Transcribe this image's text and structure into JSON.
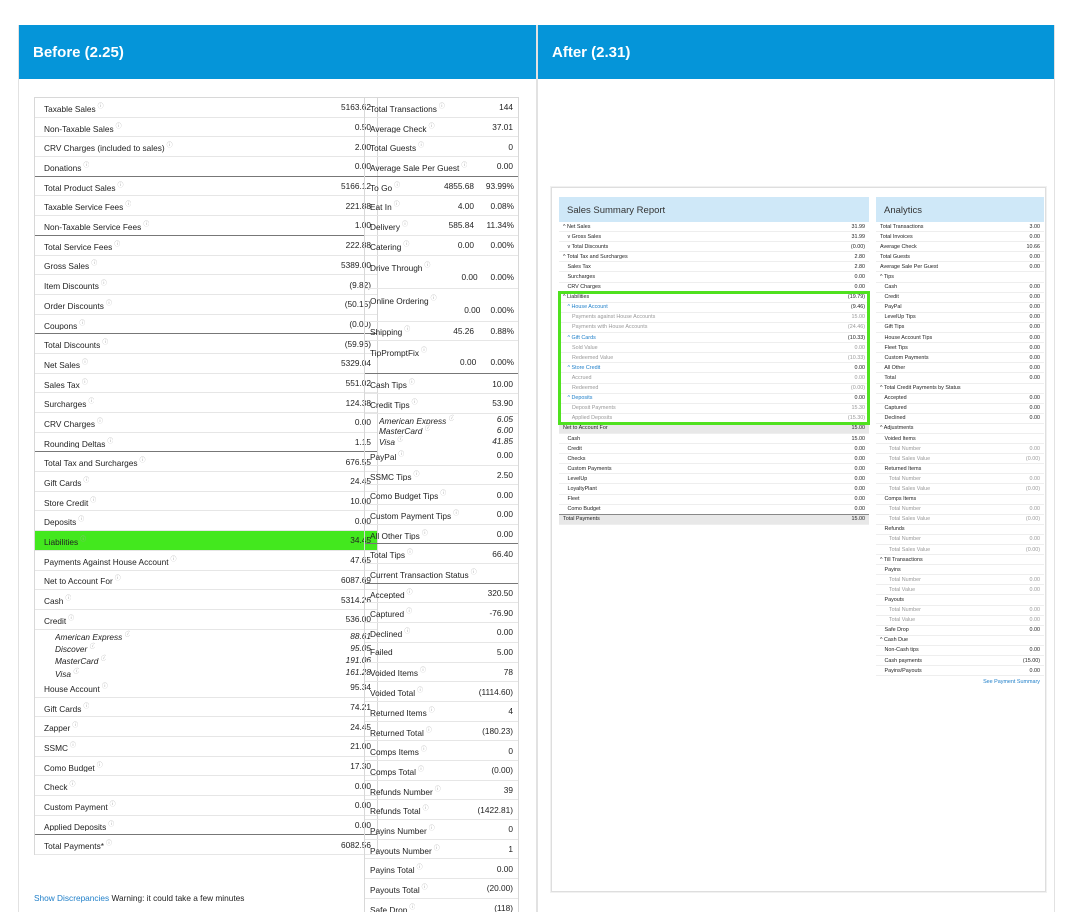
{
  "before_title": "Before (2.25)",
  "after_title": "After (2.31)",
  "old_left": [
    {
      "l": "Taxable Sales",
      "v": "5163.62",
      "i": 1
    },
    {
      "l": "Non-Taxable Sales",
      "v": "0.50",
      "i": 1
    },
    {
      "l": "CRV Charges (included to sales)",
      "v": "2.00",
      "i": 1
    },
    {
      "l": "Donations",
      "v": "0.00",
      "i": 1,
      "bt": 1
    },
    {
      "l": "Total Product Sales",
      "v": "5166.12",
      "i": 1
    },
    {
      "l": "Taxable Service Fees",
      "v": "221.88",
      "i": 1
    },
    {
      "l": "Non-Taxable Service Fees",
      "v": "1.00",
      "i": 1,
      "bt": 1
    },
    {
      "l": "Total Service Fees",
      "v": "222.88",
      "i": 1
    },
    {
      "l": "Gross Sales",
      "v": "5389.00",
      "i": 1
    },
    {
      "l": "Item Discounts",
      "v": "(9.82)",
      "i": 1
    },
    {
      "l": "Order Discounts",
      "v": "(50.15)",
      "i": 1
    },
    {
      "l": "Coupons",
      "v": "(0.00)",
      "i": 1,
      "bt": 1
    },
    {
      "l": "Total Discounts",
      "v": "(59.96)",
      "i": 1
    },
    {
      "l": "Net Sales",
      "v": "5329.04",
      "i": 1
    },
    {
      "l": "Sales Tax",
      "v": "551.02",
      "i": 1
    },
    {
      "l": "Surcharges",
      "v": "124.38",
      "i": 1
    },
    {
      "l": "CRV Charges",
      "v": "0.00",
      "i": 1
    },
    {
      "l": "Rounding Deltas",
      "v": "1.15",
      "i": 1,
      "bt": 1
    },
    {
      "l": "Total Tax and Surcharges",
      "v": "676.55",
      "i": 1
    },
    {
      "l": "Gift Cards",
      "v": "24.45",
      "i": 1
    },
    {
      "l": "Store Credit",
      "v": "10.00",
      "i": 1
    },
    {
      "l": "Deposits",
      "v": "0.00",
      "i": 1
    },
    {
      "l": "Liabilities",
      "v": "34.45",
      "i": 1,
      "hl": 1
    },
    {
      "l": "Payments Against House Account",
      "v": "47.65",
      "i": 1
    },
    {
      "l": "Net to Account For",
      "v": "6087.69",
      "i": 1
    },
    {
      "l": "Cash",
      "v": "5314.26",
      "i": 1
    },
    {
      "l": "Credit",
      "v": "536.00",
      "i": 1
    },
    {
      "l": "American Express",
      "v": "88.61",
      "i": 1,
      "sub": 1
    },
    {
      "l": "Discover",
      "v": "95.05",
      "i": 1,
      "sub": 1
    },
    {
      "l": "MasterCard",
      "v": "191.06",
      "i": 1,
      "sub": 1
    },
    {
      "l": "Visa",
      "v": "161.28",
      "i": 1,
      "sub": 1
    },
    {
      "l": "House Account",
      "v": "95.34",
      "i": 1
    },
    {
      "l": "Gift Cards",
      "v": "74.21",
      "i": 1
    },
    {
      "l": "Zapper",
      "v": "24.45",
      "i": 1
    },
    {
      "l": "SSMC",
      "v": "21.00",
      "i": 1
    },
    {
      "l": "Como Budget",
      "v": "17.30",
      "i": 1
    },
    {
      "l": "Check",
      "v": "0.00",
      "i": 1
    },
    {
      "l": "Custom Payment",
      "v": "0.00",
      "i": 1
    },
    {
      "l": "Applied Deposits",
      "v": "0.00",
      "i": 1,
      "bt": 1
    },
    {
      "l": "Total Payments*",
      "v": "6082.56",
      "i": 1
    }
  ],
  "old_footer_link": "Show Discrepancies",
  "old_footer_text": " Warning: it could take a few minutes",
  "old_right": [
    {
      "l": "Total Transactions",
      "v": "144",
      "i": 1
    },
    {
      "l": "Average Check",
      "v": "37.01",
      "i": 1
    },
    {
      "l": "Total Guests",
      "v": "0",
      "i": 1
    },
    {
      "l": "Average Sale Per Guest",
      "v": "0.00",
      "i": 1,
      "bt": 1
    },
    {
      "l": "To Go",
      "a": "4855.68",
      "b": "93.99%",
      "i": 1,
      "t3": 1
    },
    {
      "l": "Eat In",
      "a": "4.00",
      "b": "0.08%",
      "i": 1,
      "t3": 1
    },
    {
      "l": "Delivery",
      "a": "585.84",
      "b": "11.34%",
      "i": 1,
      "t3": 1
    },
    {
      "l": "Catering",
      "a": "0.00",
      "b": "0.00%",
      "i": 1,
      "t3": 1
    },
    {
      "l": "Drive Through",
      "a": "0.00",
      "b": "0.00%",
      "i": 1,
      "t3": 1,
      "tall": 1
    },
    {
      "l": "Online Ordering",
      "a": "0.00",
      "b": "0.00%",
      "i": 1,
      "t3": 1,
      "tall": 1
    },
    {
      "l": "Shipping",
      "a": "45.26",
      "b": "0.88%",
      "i": 1,
      "t3": 1
    },
    {
      "l": "TipPromptFix",
      "a": "0.00",
      "b": "0.00%",
      "i": 1,
      "t3": 1,
      "tall": 1,
      "bt": 1
    },
    {
      "l": "Cash Tips",
      "v": "10.00",
      "i": 1
    },
    {
      "l": "Credit Tips",
      "v": "53.90",
      "i": 1
    },
    {
      "l": "American Express",
      "v": "6.05",
      "i": 1,
      "sub2": 1
    },
    {
      "l": "MasterCard",
      "v": "6.00",
      "i": 1,
      "sub2": 1
    },
    {
      "l": "Visa",
      "v": "41.85",
      "i": 1,
      "sub2": 1
    },
    {
      "l": "PayPal",
      "v": "0.00",
      "i": 1
    },
    {
      "l": "SSMC Tips",
      "v": "2.50",
      "i": 1
    },
    {
      "l": "Como Budget Tips",
      "v": "0.00",
      "i": 1
    },
    {
      "l": "Custom Payment Tips",
      "v": "0.00",
      "i": 1
    },
    {
      "l": "All Other Tips",
      "v": "0.00",
      "i": 1,
      "bt": 1
    },
    {
      "l": "Total Tips",
      "v": "66.40",
      "i": 1
    },
    {
      "l": "Current Transaction Status",
      "v": "",
      "i": 1,
      "bt": 1
    },
    {
      "l": "Accepted",
      "v": "320.50",
      "i": 1
    },
    {
      "l": "Captured",
      "v": "-76.90",
      "i": 1
    },
    {
      "l": "Declined",
      "v": "0.00",
      "i": 1
    },
    {
      "l": "Failed",
      "v": "5.00",
      "i": 0
    },
    {
      "l": "Voided Items",
      "v": "78",
      "i": 1
    },
    {
      "l": "Voided Total",
      "v": "(1114.60)",
      "i": 1
    },
    {
      "l": "Returned Items",
      "v": "4",
      "i": 1
    },
    {
      "l": "Returned Total",
      "v": "(180.23)",
      "i": 1
    },
    {
      "l": "Comps Items",
      "v": "0",
      "i": 1
    },
    {
      "l": "Comps Total",
      "v": "(0.00)",
      "i": 1
    },
    {
      "l": "Refunds Number",
      "v": "39",
      "i": 1
    },
    {
      "l": "Refunds Total",
      "v": "(1422.81)",
      "i": 1
    },
    {
      "l": "Payins Number",
      "v": "0",
      "i": 1
    },
    {
      "l": "Payouts Number",
      "v": "1",
      "i": 1
    },
    {
      "l": "Payins Total",
      "v": "0.00",
      "i": 1
    },
    {
      "l": "Payouts Total",
      "v": "(20.00)",
      "i": 1
    },
    {
      "l": "Safe Drop",
      "v": "(118)",
      "i": 1
    }
  ],
  "new_ssr_title": "Sales Summary Report",
  "new_ssr": [
    {
      "l": "^ Net Sales",
      "v": "31.99"
    },
    {
      "l": "   v Gross Sales",
      "v": "31.99"
    },
    {
      "l": "   v Total Discounts",
      "v": "(0.00)"
    },
    {
      "l": "^ Total Tax and Surcharges",
      "v": "2.80"
    },
    {
      "l": "   Sales Tax",
      "v": "2.80"
    },
    {
      "l": "   Surcharges",
      "v": "0.00"
    },
    {
      "l": "   CRV Charges",
      "v": "0.00",
      "b": 1
    },
    {
      "l": "^ Liabilities",
      "v": "(19.79)"
    },
    {
      "l": "   ^ House Account",
      "v": "(9.46)",
      "blue": 1
    },
    {
      "l": "      Payments against House Accounts",
      "v": "15.00",
      "grey": 1
    },
    {
      "l": "      Payments with House Accounts",
      "v": "(24.46)",
      "grey": 1
    },
    {
      "l": "   ^ Gift Cards",
      "v": "(10.33)",
      "blue": 1
    },
    {
      "l": "      Sold Value",
      "v": "0.00",
      "grey": 1
    },
    {
      "l": "      Redeemed Value",
      "v": "(10.33)",
      "grey": 1
    },
    {
      "l": "   ^ Store Credit",
      "v": "0.00",
      "blue": 1
    },
    {
      "l": "      Accrued",
      "v": "0.00",
      "grey": 1
    },
    {
      "l": "      Redeemed",
      "v": "(0.00)",
      "grey": 1
    },
    {
      "l": "   ^ Deposits",
      "v": "0.00",
      "blue": 1
    },
    {
      "l": "      Deposit Payments",
      "v": "15.30",
      "grey": 1
    },
    {
      "l": "      Applied Deposits",
      "v": "(15.30)",
      "grey": 1,
      "b": 1
    },
    {
      "l": "Net to Account For",
      "v": "15.00",
      "dk": 1
    },
    {
      "l": "   Cash",
      "v": "15.00"
    },
    {
      "l": "   Credit",
      "v": "0.00"
    },
    {
      "l": "   Checks",
      "v": "0.00"
    },
    {
      "l": "   Custom Payments",
      "v": "0.00"
    },
    {
      "l": "   LevelUp",
      "v": "0.00"
    },
    {
      "l": "   LoyaltyPlant",
      "v": "0.00"
    },
    {
      "l": "   Fleet",
      "v": "0.00"
    },
    {
      "l": "   Como Budget",
      "v": "0.00",
      "b": 1
    },
    {
      "l": "Total Payments",
      "v": "15.00",
      "dk": 1
    }
  ],
  "new_ana_title": "Analytics",
  "new_ana": [
    {
      "l": "Total Transactions",
      "v": "3.00"
    },
    {
      "l": "Total Invoices",
      "v": "0.00"
    },
    {
      "l": "Average Check",
      "v": "10.66"
    },
    {
      "l": "Total Guests",
      "v": "0.00"
    },
    {
      "l": "Average Sale Per Guest",
      "v": "0.00"
    },
    {
      "l": "^ Tips",
      "v": ""
    },
    {
      "l": "   Cash",
      "v": "0.00"
    },
    {
      "l": "   Credit",
      "v": "0.00"
    },
    {
      "l": "   PayPal",
      "v": "0.00"
    },
    {
      "l": "   LevelUp Tips",
      "v": "0.00"
    },
    {
      "l": "   Gift Tips",
      "v": "0.00"
    },
    {
      "l": "   House Account Tips",
      "v": "0.00"
    },
    {
      "l": "   Fleet Tips",
      "v": "0.00"
    },
    {
      "l": "   Custom Payments",
      "v": "0.00"
    },
    {
      "l": "   All Other",
      "v": "0.00"
    },
    {
      "l": "   Total",
      "v": "0.00"
    },
    {
      "l": "^ Total Credit Payments by Status",
      "v": ""
    },
    {
      "l": "   Accepted",
      "v": "0.00"
    },
    {
      "l": "   Captured",
      "v": "0.00"
    },
    {
      "l": "   Declined",
      "v": "0.00"
    },
    {
      "l": "^ Adjustments",
      "v": ""
    },
    {
      "l": "   Voided Items",
      "v": ""
    },
    {
      "l": "      Total Number",
      "v": "0.00",
      "grey": 1
    },
    {
      "l": "      Total Sales Value",
      "v": "(0.00)",
      "grey": 1
    },
    {
      "l": "   Returned Items",
      "v": ""
    },
    {
      "l": "      Total Number",
      "v": "0.00",
      "grey": 1
    },
    {
      "l": "      Total Sales Value",
      "v": "(0.00)",
      "grey": 1
    },
    {
      "l": "   Comps Items",
      "v": ""
    },
    {
      "l": "      Total Number",
      "v": "0.00",
      "grey": 1
    },
    {
      "l": "      Total Sales Value",
      "v": "(0.00)",
      "grey": 1
    },
    {
      "l": "   Refunds",
      "v": ""
    },
    {
      "l": "      Total Number",
      "v": "0.00",
      "grey": 1
    },
    {
      "l": "      Total Sales Value",
      "v": "(0.00)",
      "grey": 1
    },
    {
      "l": "^ Till Transactions",
      "v": ""
    },
    {
      "l": "   Payins",
      "v": ""
    },
    {
      "l": "      Total Number",
      "v": "0.00",
      "grey": 1
    },
    {
      "l": "      Total Value",
      "v": "0.00",
      "grey": 1
    },
    {
      "l": "   Payouts",
      "v": ""
    },
    {
      "l": "      Total Number",
      "v": "0.00",
      "grey": 1
    },
    {
      "l": "      Total Value",
      "v": "0.00",
      "grey": 1
    },
    {
      "l": "   Safe Drop",
      "v": "0.00"
    },
    {
      "l": "^ Cash Due",
      "v": ""
    },
    {
      "l": "   Non-Cash tips",
      "v": "0.00"
    },
    {
      "l": "   Cash payments",
      "v": "(15.00)"
    },
    {
      "l": "   Payins/Payouts",
      "v": "0.00"
    }
  ],
  "new_ana_link": "See Payment Summary",
  "colors": {
    "header": "#0595d9",
    "highlight": "#43e81e",
    "panel_head": "#cfe8f8",
    "green_box": "#4fe11f",
    "link": "#1f7fc9"
  }
}
